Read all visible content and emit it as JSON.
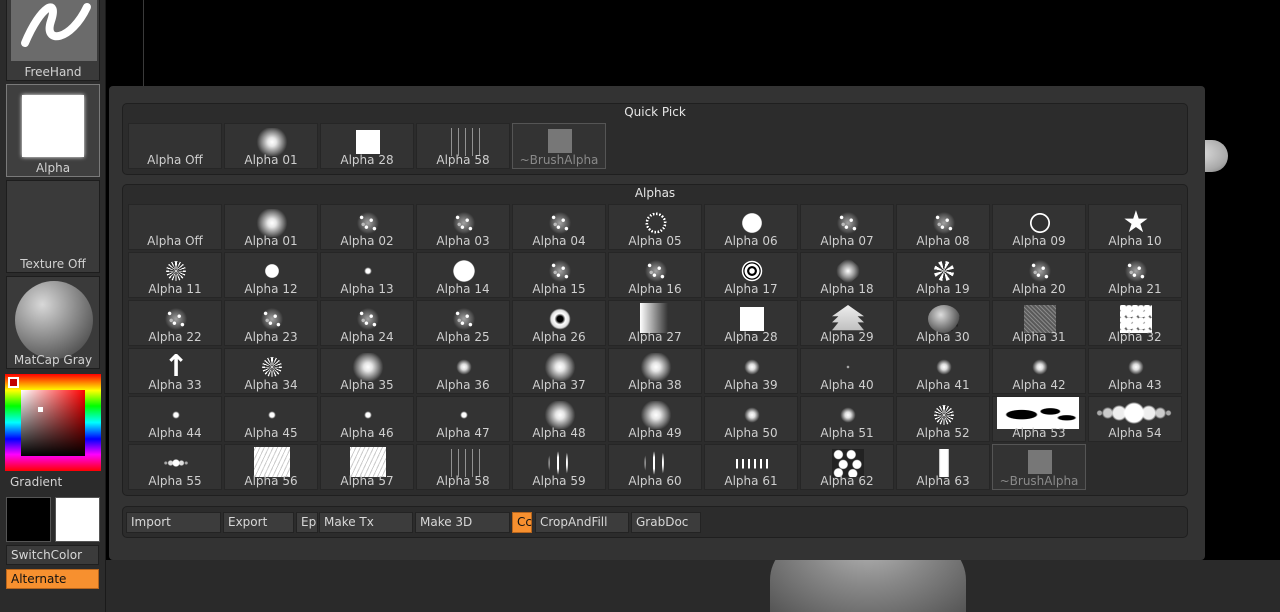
{
  "shelf": {
    "brush_label": "FreeHand",
    "alpha_label": "Alpha",
    "texture_label": "Texture Off",
    "material_label": "MatCap Gray",
    "gradient_label": "Gradient",
    "switch_color_label": "SwitchColor",
    "alternate_label": "Alternate"
  },
  "colors": {
    "accent_orange": "#f7902f",
    "panel_bg": "#2c2c2c"
  },
  "quick_pick": {
    "title": "Quick Pick",
    "items": [
      {
        "label": "Alpha Off",
        "thumb": ""
      },
      {
        "label": "Alpha 01",
        "thumb": "t-soft"
      },
      {
        "label": "Alpha 28",
        "thumb": "t-square"
      },
      {
        "label": "Alpha 58",
        "thumb": "t-woodlines"
      },
      {
        "label": "~BrushAlpha",
        "thumb": "t-graybox",
        "dim": true
      }
    ]
  },
  "alphas": {
    "title": "Alphas",
    "items": [
      {
        "label": "Alpha Off",
        "thumb": ""
      },
      {
        "label": "Alpha 01",
        "thumb": "t-soft"
      },
      {
        "label": "Alpha 02",
        "thumb": "t-noise"
      },
      {
        "label": "Alpha 03",
        "thumb": "t-noise"
      },
      {
        "label": "Alpha 04",
        "thumb": "t-noise"
      },
      {
        "label": "Alpha 05",
        "thumb": "t-dashring"
      },
      {
        "label": "Alpha 06",
        "thumb": "t-disc"
      },
      {
        "label": "Alpha 07",
        "thumb": "t-noise"
      },
      {
        "label": "Alpha 08",
        "thumb": "t-noise"
      },
      {
        "label": "Alpha 09",
        "thumb": "t-ring"
      },
      {
        "label": "Alpha 10",
        "thumb": "t-star"
      },
      {
        "label": "Alpha 11",
        "thumb": "t-starburst"
      },
      {
        "label": "Alpha 12",
        "thumb": "t-discsmall"
      },
      {
        "label": "Alpha 13",
        "thumb": "t-dot"
      },
      {
        "label": "Alpha 14",
        "thumb": "t-discbig"
      },
      {
        "label": "Alpha 15",
        "thumb": "t-noise"
      },
      {
        "label": "Alpha 16",
        "thumb": "t-noise"
      },
      {
        "label": "Alpha 17",
        "thumb": "t-target"
      },
      {
        "label": "Alpha 18",
        "thumb": "t-diamond"
      },
      {
        "label": "Alpha 19",
        "thumb": "t-swirl"
      },
      {
        "label": "Alpha 20",
        "thumb": "t-noise"
      },
      {
        "label": "Alpha 21",
        "thumb": "t-noise"
      },
      {
        "label": "Alpha 22",
        "thumb": "t-noise"
      },
      {
        "label": "Alpha 23",
        "thumb": "t-noise"
      },
      {
        "label": "Alpha 24",
        "thumb": "t-noise"
      },
      {
        "label": "Alpha 25",
        "thumb": "t-noise"
      },
      {
        "label": "Alpha 26",
        "thumb": "t-donut"
      },
      {
        "label": "Alpha 27",
        "thumb": "t-gradrect"
      },
      {
        "label": "Alpha 28",
        "thumb": "t-square"
      },
      {
        "label": "Alpha 29",
        "thumb": "t-chev"
      },
      {
        "label": "Alpha 30",
        "thumb": "t-ball"
      },
      {
        "label": "Alpha 31",
        "thumb": "t-texture"
      },
      {
        "label": "Alpha 32",
        "thumb": "t-cells"
      },
      {
        "label": "Alpha 33",
        "thumb": "t-arrow"
      },
      {
        "label": "Alpha 34",
        "thumb": "t-starburst"
      },
      {
        "label": "Alpha 35",
        "thumb": "t-soft"
      },
      {
        "label": "Alpha 36",
        "thumb": "t-softsmall"
      },
      {
        "label": "Alpha 37",
        "thumb": "t-soft"
      },
      {
        "label": "Alpha 38",
        "thumb": "t-soft"
      },
      {
        "label": "Alpha 39",
        "thumb": "t-softsmall"
      },
      {
        "label": "Alpha 40",
        "thumb": "t-tiny"
      },
      {
        "label": "Alpha 41",
        "thumb": "t-softsmall"
      },
      {
        "label": "Alpha 42",
        "thumb": "t-softsmall"
      },
      {
        "label": "Alpha 43",
        "thumb": "t-softsmall"
      },
      {
        "label": "Alpha 44",
        "thumb": "t-dot"
      },
      {
        "label": "Alpha 45",
        "thumb": "t-dot"
      },
      {
        "label": "Alpha 46",
        "thumb": "t-dot"
      },
      {
        "label": "Alpha 47",
        "thumb": "t-dot"
      },
      {
        "label": "Alpha 48",
        "thumb": "t-soft"
      },
      {
        "label": "Alpha 49",
        "thumb": "t-soft"
      },
      {
        "label": "Alpha 50",
        "thumb": "t-softsmall"
      },
      {
        "label": "Alpha 51",
        "thumb": "t-softsmall"
      },
      {
        "label": "Alpha 52",
        "thumb": "t-starburst"
      },
      {
        "label": "Alpha 53",
        "thumb": "t-wide t-logo"
      },
      {
        "label": "Alpha 54",
        "thumb": "t-wide t-dotrow"
      },
      {
        "label": "Alpha 55",
        "thumb": "t-dotsmall"
      },
      {
        "label": "Alpha 56",
        "thumb": "t-scratch"
      },
      {
        "label": "Alpha 57",
        "thumb": "t-scratch"
      },
      {
        "label": "Alpha 58",
        "thumb": "t-woodlines"
      },
      {
        "label": "Alpha 59",
        "thumb": "t-bars"
      },
      {
        "label": "Alpha 60",
        "thumb": "t-bars"
      },
      {
        "label": "Alpha 61",
        "thumb": "t-smallbars"
      },
      {
        "label": "Alpha 62",
        "thumb": "t-blots"
      },
      {
        "label": "Alpha 63",
        "thumb": "t-column"
      },
      {
        "label": "~BrushAlpha",
        "thumb": "t-graybox",
        "dim": true
      }
    ]
  },
  "toolbar": {
    "import_label": "Import",
    "export_label": "Export",
    "ep_label": "Ep",
    "make_tx_label": "Make Tx",
    "make_3d_label": "Make 3D",
    "cc_label": "Cc",
    "crop_and_fill_label": "CropAndFill",
    "grab_doc_label": "GrabDoc"
  }
}
